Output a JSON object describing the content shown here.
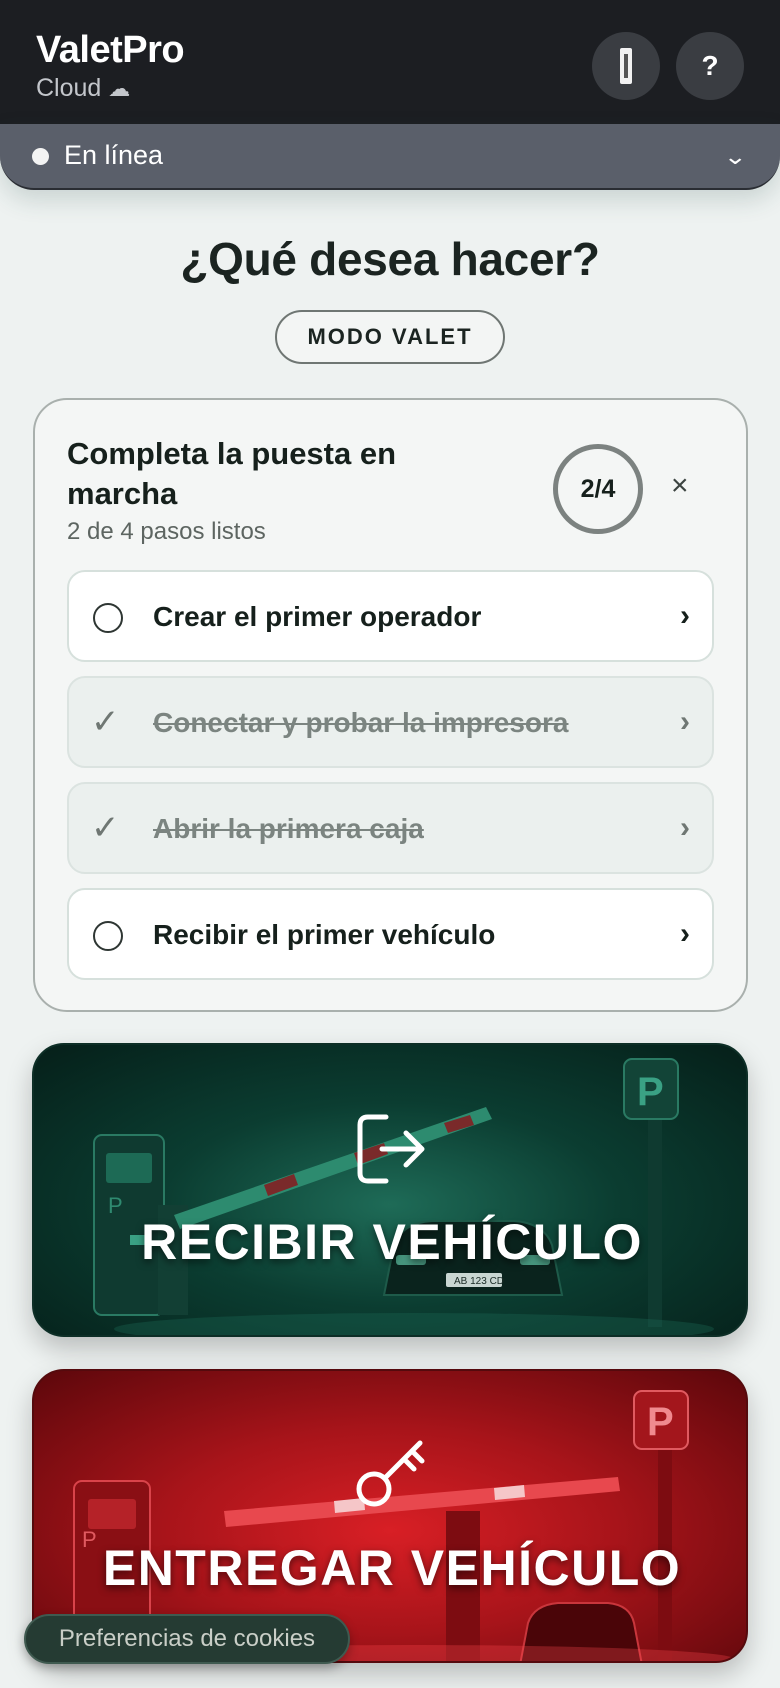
{
  "header": {
    "app_name": "ValetPro",
    "app_subtitle": "Cloud",
    "cloud_glyph": "☁",
    "help_label": "?",
    "printer_icon": "printer-icon"
  },
  "status": {
    "text": "En línea",
    "chevron": "⌄"
  },
  "main": {
    "heading": "¿Qué desea hacer?",
    "mode_label": "MODO VALET"
  },
  "setup": {
    "title": "Completa la puesta en marcha",
    "subtitle": "2 de 4 pasos listos",
    "progress_text": "2/4",
    "close_glyph": "×",
    "steps": [
      {
        "label": "Crear el primer operador",
        "done": false
      },
      {
        "label": "Conectar y probar la impresora",
        "done": true
      },
      {
        "label": "Abrir la primera caja",
        "done": true
      },
      {
        "label": "Recibir el primer vehículo",
        "done": false
      }
    ],
    "check_glyph": "✓",
    "arrow_glyph": "›"
  },
  "actions": {
    "receive_label": "RECIBIR VEHÍCULO",
    "deliver_label": "ENTREGAR VEHÍCULO",
    "receive_plate": "AB 123 CD",
    "colors": {
      "receive": "#0b3d31",
      "deliver": "#a8141a"
    }
  },
  "cookie": {
    "label": "Preferencias de cookies"
  }
}
